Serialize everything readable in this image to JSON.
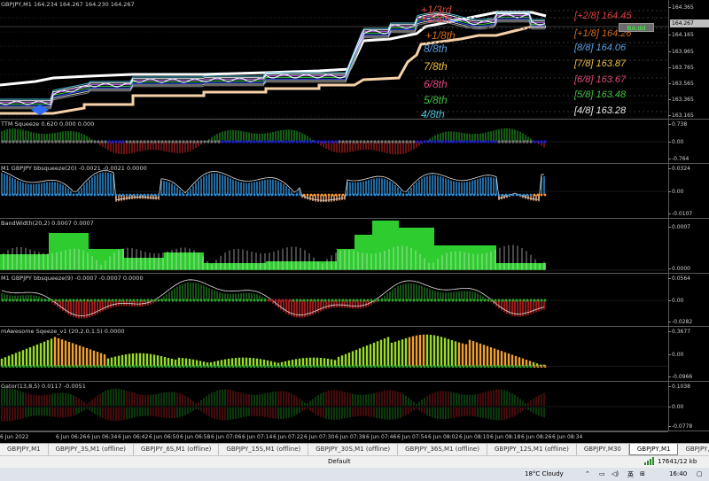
{
  "main_pane": {
    "title": "GBPJPY,M1  164.234 164.267 164.230 164.267",
    "price_ticks": [
      "164.365",
      "164.267",
      "164.165",
      "163.965",
      "163.765",
      "163.565",
      "163.365",
      "163.165"
    ],
    "current_price": "164.267",
    "ba_box": "BA:dd",
    "murrey_left": [
      {
        "text": "+1/3rd",
        "color": "#e0403c"
      },
      {
        "text": "+2/8th",
        "color": "#e0403c"
      },
      {
        "text": "+1/8th",
        "color": "#d06a1c"
      },
      {
        "text": "8/8th",
        "color": "#5a9fe6"
      },
      {
        "text": "7/8th",
        "color": "#f0c040"
      },
      {
        "text": "6/8th",
        "color": "#e04680"
      },
      {
        "text": "5/8th",
        "color": "#40c040"
      },
      {
        "text": "4/8th",
        "color": "#4fc0d8"
      }
    ],
    "murrey_right": [
      {
        "label": "[+2/8]",
        "value": "164.45",
        "color": "#e0403c"
      },
      {
        "label": "[+1/8]",
        "value": "164.26",
        "color": "#d06a1c"
      },
      {
        "label": "[8/8]",
        "value": "164.06",
        "color": "#5a9fe6"
      },
      {
        "label": "[7/8]",
        "value": "163.87",
        "color": "#f0c040"
      },
      {
        "label": "[6/8]",
        "value": "163.67",
        "color": "#e04680"
      },
      {
        "label": "[5/8]",
        "value": "163.48",
        "color": "#40c040"
      },
      {
        "label": "[4/8]",
        "value": "163.28",
        "color": "#e8e8e8"
      }
    ]
  },
  "panes": [
    {
      "title": "TTM Squeeze 0.620 0.000 0.000",
      "ticks": [
        "0.738",
        "0.00",
        "-0.764"
      ]
    },
    {
      "title": "M1 GBPJPY bbsqueeze(20) -0.0021 -0.0021 0.0000",
      "ticks": [
        "0.0324",
        "0.00",
        "-0.0107"
      ]
    },
    {
      "title": "BandWidth(20,2) 0.0007 0.0007",
      "ticks": [
        "0.0007",
        "0.0000"
      ]
    },
    {
      "title": "M1 GBPJPY bbsqueeze(9) -0.0007 -0.0007 0.0000",
      "ticks": [
        "0.0564",
        "0.00",
        "-0.0282"
      ]
    },
    {
      "title": "mAwesome Sqeeze_v1 (20,2.0,1.5) 0.0000",
      "ticks": [
        "0.3677",
        "0.00",
        "-0.0966"
      ]
    },
    {
      "title": "Gator(13,8,5) 0.0117 -0.0051",
      "ticks": [
        "0.1038",
        "0.00",
        "-0.0778"
      ]
    }
  ],
  "time_labels": [
    "6 Jun 2022",
    "6 Jun 06:26",
    "6 Jun 06:34",
    "6 Jun 06:42",
    "6 Jun 06:50",
    "6 Jun 06:58",
    "6 Jun 07:06",
    "6 Jun 07:14",
    "6 Jun 07:22",
    "6 Jun 07:30",
    "6 Jun 07:38",
    "6 Jun 07:46",
    "6 Jun 07:54",
    "6 Jun 08:02",
    "6 Jun 08:10",
    "6 Jun 08:18",
    "6 Jun 08:26",
    "6 Jun 08:34"
  ],
  "tabs": [
    "GBPJPY,M1",
    "GBPJPY_3S,M1 (offline)",
    "GBPJPY_6S,M1 (offline)",
    "GBPJPY_15S,M1 (offline)",
    "GBPJPY_30S,M1 (offline)",
    "GBPJPY_36S,M1 (offline)",
    "GBPJPY_12S,M1 (offline)",
    "GBPJPY,M30",
    "GBPJPY,M1",
    "GBPJPY,M1"
  ],
  "active_tab_index": 8,
  "status": {
    "profile": "Default",
    "connection": "17641/12 kb"
  },
  "taskbar": {
    "weather": "18°C  Cloudy",
    "lang": "英",
    "time": "16:40"
  },
  "colors": {
    "up_bar": "#2d8cd6",
    "down_bar": "#e8a070",
    "green": "#2ecc2e",
    "red": "#cc2222",
    "blue_dot": "#1a1aff"
  }
}
